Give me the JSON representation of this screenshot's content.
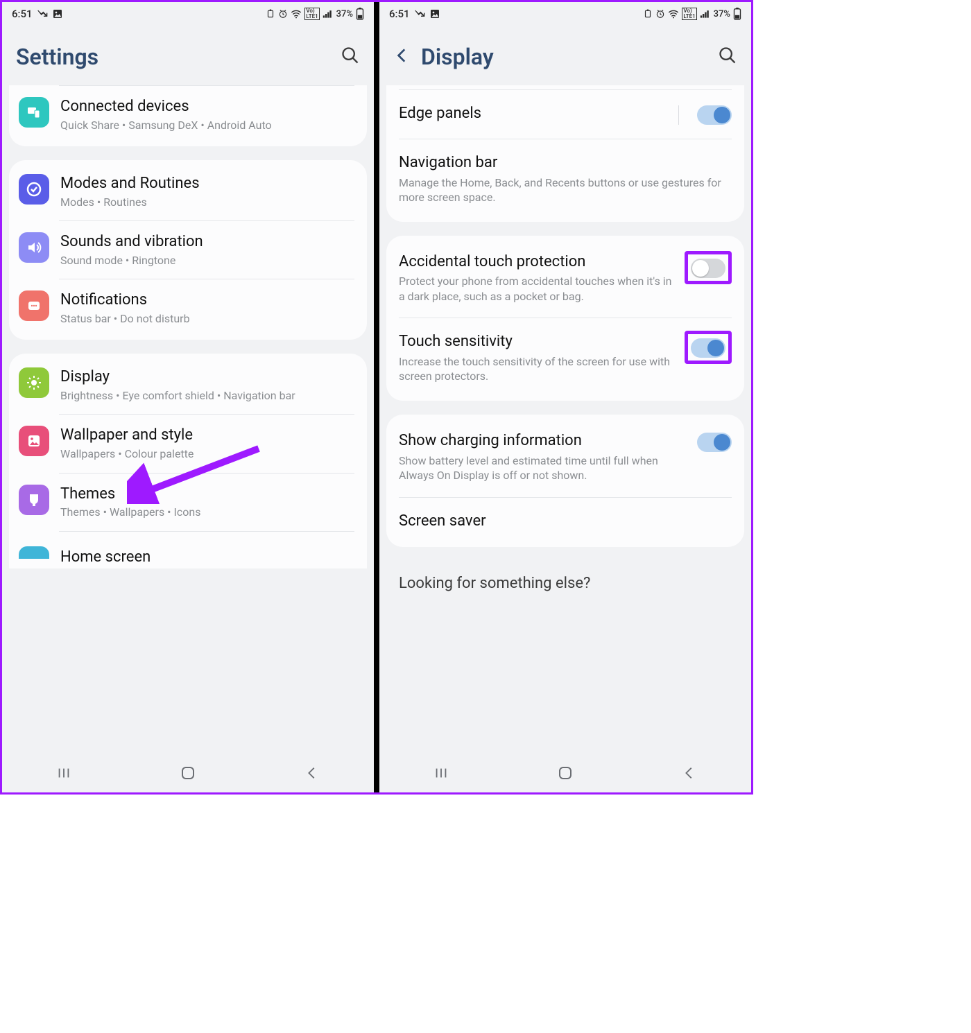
{
  "status": {
    "time": "6:51",
    "battery_text": "37%"
  },
  "left": {
    "header_title": "Settings",
    "groups": [
      {
        "rows": [
          {
            "id": "connected",
            "icon_color": "#2ec7bf",
            "title": "Connected devices",
            "sub": "Quick Share  •  Samsung DeX  •  Android Auto"
          }
        ],
        "cut_top": true
      },
      {
        "rows": [
          {
            "id": "modes",
            "icon_color": "#5a5de8",
            "title": "Modes and Routines",
            "sub": "Modes  •  Routines"
          },
          {
            "id": "sounds",
            "icon_color": "#8d8cf5",
            "title": "Sounds and vibration",
            "sub": "Sound mode  •  Ringtone"
          },
          {
            "id": "notifications",
            "icon_color": "#f0736b",
            "title": "Notifications",
            "sub": "Status bar  •  Do not disturb"
          }
        ]
      },
      {
        "rows": [
          {
            "id": "display",
            "icon_color": "#8fc93a",
            "title": "Display",
            "sub": "Brightness  •  Eye comfort shield  •  Navigation bar"
          },
          {
            "id": "wallpaper",
            "icon_color": "#e84f7a",
            "title": "Wallpaper and style",
            "sub": "Wallpapers  •  Colour palette"
          },
          {
            "id": "themes",
            "icon_color": "#a86ae6",
            "title": "Themes",
            "sub": "Themes  •  Wallpapers  •  Icons"
          }
        ],
        "peek_title": "Home screen",
        "cut_bottom": true
      }
    ]
  },
  "right": {
    "header_title": "Display",
    "group1": [
      {
        "id": "edge",
        "title": "Edge panels",
        "sub": "",
        "toggle": true,
        "toggle_sep": true
      },
      {
        "id": "navbar",
        "title": "Navigation bar",
        "sub": "Manage the Home, Back, and Recents buttons or use gestures for more screen space."
      }
    ],
    "group2": [
      {
        "id": "atp",
        "title": "Accidental touch protection",
        "sub": "Protect your phone from accidental touches when it's in a dark place, such as a pocket or bag.",
        "toggle": false,
        "highlight": true
      },
      {
        "id": "touch",
        "title": "Touch sensitivity",
        "sub": "Increase the touch sensitivity of the screen for use with screen protectors.",
        "toggle": true,
        "highlight": true
      }
    ],
    "group3": [
      {
        "id": "charging",
        "title": "Show charging information",
        "sub": "Show battery level and estimated time until full when Always On Display is off or not shown.",
        "toggle": true
      },
      {
        "id": "saver",
        "title": "Screen saver",
        "sub": ""
      }
    ],
    "looking": "Looking for something else?"
  },
  "icons": {
    "connected": "devices",
    "modes": "check-circle",
    "sounds": "volume",
    "notifications": "bell",
    "display": "sun",
    "wallpaper": "image",
    "themes": "brush"
  }
}
